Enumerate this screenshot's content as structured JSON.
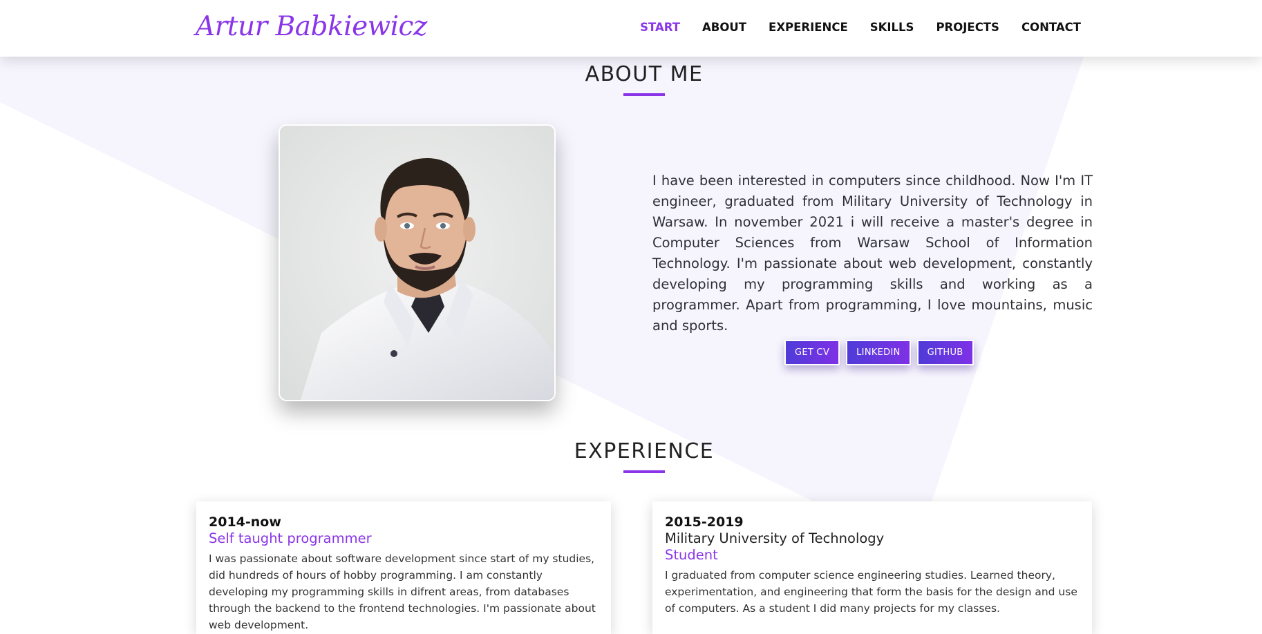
{
  "header": {
    "logo": "Artur Babkiewicz",
    "nav": [
      {
        "label": "START",
        "active": true
      },
      {
        "label": "ABOUT",
        "active": false
      },
      {
        "label": "EXPERIENCE",
        "active": false
      },
      {
        "label": "SKILLS",
        "active": false
      },
      {
        "label": "PROJECTS",
        "active": false
      },
      {
        "label": "CONTACT",
        "active": false
      }
    ]
  },
  "about": {
    "title": "ABOUT ME",
    "text": "I have been interested in computers since childhood. Now I'm IT engineer, graduated from Military University of Technology in Warsaw. In november 2021 i will receive a master's degree in Computer Sciences from Warsaw School of Information Technology. I'm passionate about web development, constantly developing my programming skills and working as a programmer. Apart from programming, I love mountains, music and sports.",
    "buttons": {
      "cv": "GET CV",
      "linkedin": "LINKEDIN",
      "github": "GITHUB"
    }
  },
  "experience": {
    "title": "EXPERIENCE",
    "items": [
      {
        "years": "2014-now",
        "role": "Self taught programmer",
        "description": "I was passionate about software development since start of my studies, did hundreds of hours of hobby programming. I am constantly developing my programming skills in difrent areas, from databases through the backend to the frontend technologies. I'm passionate about web development."
      },
      {
        "years": "2015-2019",
        "organization": "Military University of Technology",
        "role": "Student",
        "description": "I graduated from computer science engineering studies. Learned theory, experimentation, and engineering that form the basis for the design and use of computers. As a student I did many projects for my classes."
      }
    ]
  },
  "colors": {
    "accent": "#8a35e8",
    "button_start": "#4f3bd8",
    "button_end": "#7f31e6",
    "background_shape": "#f6f5fd"
  }
}
